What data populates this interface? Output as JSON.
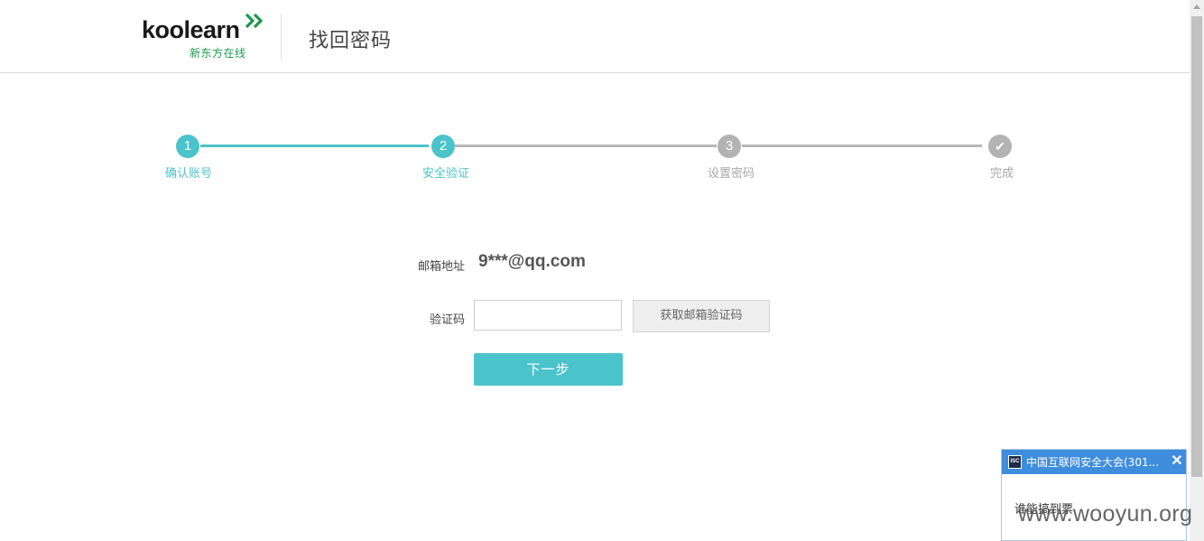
{
  "header": {
    "logo_text": "koolearn",
    "logo_subtitle": "新东方在线",
    "page_title": "找回密码"
  },
  "steps": [
    {
      "number": "1",
      "label": "确认账号",
      "state": "done"
    },
    {
      "number": "2",
      "label": "安全验证",
      "state": "current"
    },
    {
      "number": "3",
      "label": "设置密码",
      "state": "todo"
    },
    {
      "number": "✔",
      "label": "完成",
      "state": "todo"
    }
  ],
  "form": {
    "email_label": "邮箱地址",
    "email_value": "9***@qq.com",
    "code_label": "验证码",
    "code_value": "",
    "get_code_button": "获取邮箱验证码",
    "next_button": "下一步"
  },
  "popup": {
    "logo_text": "ISC",
    "title": "中国互联网安全大会(301...",
    "close_label": "✕",
    "body_text": "谁能搞到票"
  },
  "watermark": "www.wooyun.org",
  "colors": {
    "accent": "#4bc3cb",
    "inactive": "#b3b3b3",
    "brand_green": "#1c9a4a",
    "popup_header": "#3f8ede"
  }
}
